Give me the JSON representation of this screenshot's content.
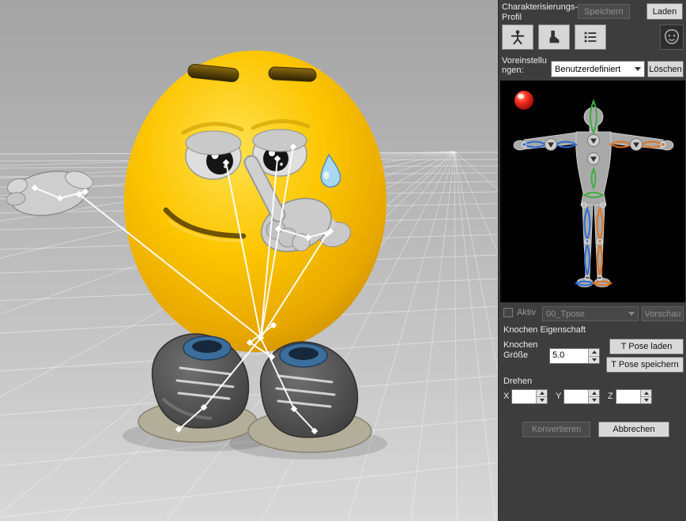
{
  "panel": {
    "title": "Charakterisierungs-Profil",
    "save_label": "Speichern",
    "load_label": "Laden",
    "presets_label": "Voreinstellungen:",
    "preset_selected": "Benutzerdefiniert",
    "delete_label": "Löschen",
    "active_label": "Aktiv",
    "pose_selected": "00_Tpose",
    "preview_label": "Vorschau",
    "bone_section_title": "Knochen Eigenschaft",
    "bone_size_label": "Knochen Größe",
    "bone_size_value": "5.0",
    "tpose_load_label": "T Pose laden",
    "tpose_save_label": "T Pose speichern",
    "rotate_label": "Drehen",
    "axis_x_label": "X",
    "axis_y_label": "Y",
    "axis_z_label": "Z",
    "axis_x_value": "",
    "axis_y_value": "",
    "axis_z_value": "",
    "convert_label": "Konvertieren",
    "cancel_label": "Abbrechen"
  },
  "icons": {
    "toolbar": [
      "body-icon",
      "foot-icon",
      "list-icon",
      "face-icon"
    ],
    "body_map_figure": "t-pose-figure",
    "bone_indicator": "red-sphere"
  },
  "colors": {
    "panel_bg": "#3d3d3d",
    "viewport_top": "#a4a4a4",
    "viewport_bottom": "#d8d8d8",
    "accent_green": "#3fae3f",
    "accent_blue": "#2b6bd4",
    "accent_orange": "#e0731f",
    "indicator_red": "#ff3020",
    "character_yellow": "#fcc500",
    "bone_white": "#ffffff"
  }
}
